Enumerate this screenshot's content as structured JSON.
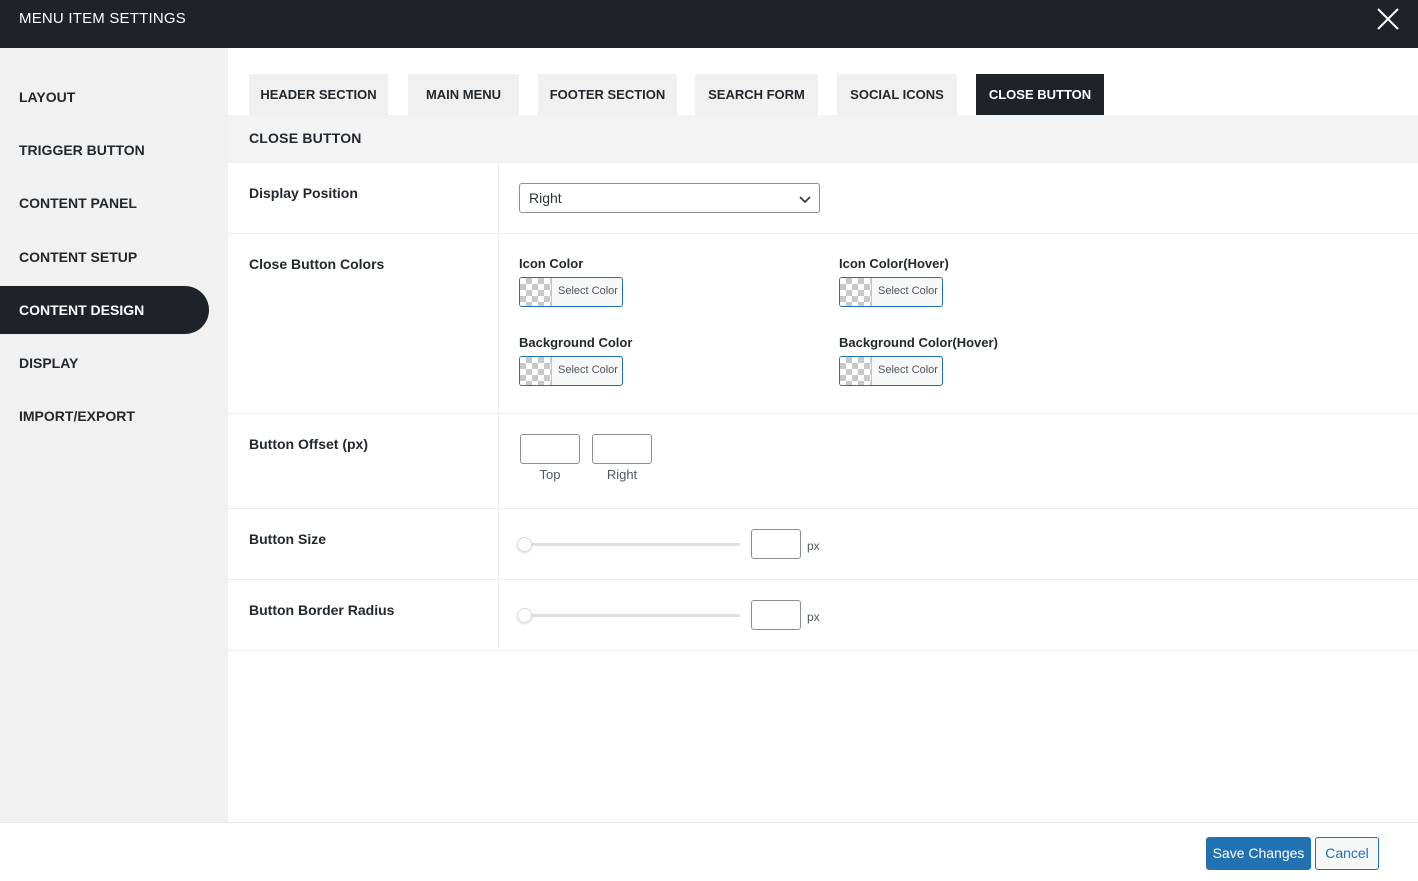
{
  "window": {
    "title": "MENU ITEM SETTINGS",
    "close_icon": "close-icon"
  },
  "sidebar": {
    "items": [
      {
        "label": "LAYOUT"
      },
      {
        "label": "TRIGGER BUTTON"
      },
      {
        "label": "CONTENT PANEL"
      },
      {
        "label": "CONTENT SETUP"
      },
      {
        "label": "CONTENT DESIGN",
        "active": true
      },
      {
        "label": "DISPLAY"
      },
      {
        "label": "IMPORT/EXPORT"
      }
    ]
  },
  "tabs": [
    {
      "label": "HEADER SECTION"
    },
    {
      "label": "MAIN MENU"
    },
    {
      "label": "FOOTER SECTION"
    },
    {
      "label": "SEARCH FORM"
    },
    {
      "label": "SOCIAL ICONS"
    },
    {
      "label": "CLOSE BUTTON",
      "active": true
    }
  ],
  "section": {
    "title": "CLOSE BUTTON",
    "display_position": {
      "label": "Display Position",
      "value": "Right"
    },
    "colors": {
      "label": "Close Button Colors",
      "button_text": "Select Color",
      "icon_color": "Icon Color",
      "icon_color_hover": "Icon Color(Hover)",
      "background_color": "Background Color",
      "background_color_hover": "Background Color(Hover)"
    },
    "offset": {
      "label": "Button Offset (px)",
      "top_label": "Top",
      "right_label": "Right",
      "top_value": "",
      "right_value": ""
    },
    "size": {
      "label": "Button Size",
      "unit": "px",
      "value": "",
      "slider_fraction": 0
    },
    "border_radius": {
      "label": "Button Border Radius",
      "unit": "px",
      "value": "",
      "slider_fraction": 0
    }
  },
  "footer": {
    "save_label": "Save Changes",
    "cancel_label": "Cancel"
  },
  "colors": {
    "dark": "#1d2327",
    "accent": "#2271b1",
    "sidebar_bg": "#f1f1f1"
  }
}
